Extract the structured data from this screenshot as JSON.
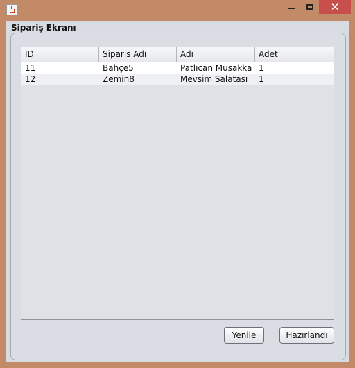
{
  "window": {
    "close_glyph": "✕"
  },
  "frame": {
    "title": "Sipariş Ekranı"
  },
  "table": {
    "columns": [
      "ID",
      "Siparis Adı",
      "Adı",
      "Adet"
    ],
    "rows": [
      [
        "11",
        "Bahçe5",
        "Patlıcan Musakka",
        "1"
      ],
      [
        "12",
        "Zemin8",
        "Mevsim Salatası",
        "1"
      ]
    ]
  },
  "buttons": {
    "refresh": "Yenile",
    "ready": "Hazırlandı"
  },
  "colors": {
    "window_border": "#c28a66",
    "close_button": "#c7504c",
    "panel_background": "#d8dbe2"
  },
  "icons": {
    "app": "java-icon",
    "minimize": "minimize-icon",
    "maximize": "maximize-icon",
    "close": "close-icon"
  }
}
